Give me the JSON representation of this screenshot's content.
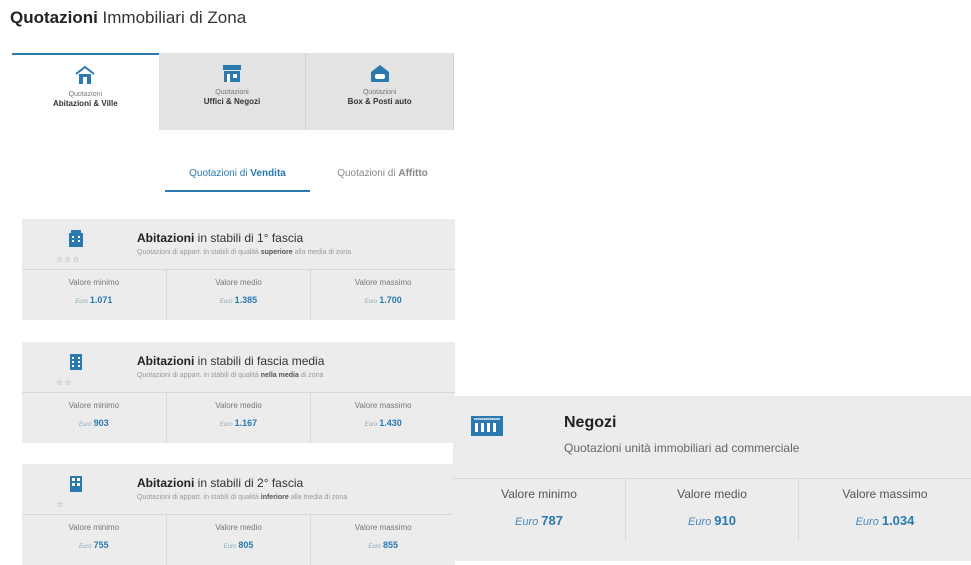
{
  "header": {
    "title_bold": "Quotazioni",
    "title_rest": " Immobiliari di Zona"
  },
  "tabs": [
    {
      "small": "Quotazioni",
      "big": "Abitazioni & Ville",
      "icon": "house-icon"
    },
    {
      "small": "Quotazioni",
      "big": "Uffici & Negozi",
      "icon": "shop-icon"
    },
    {
      "small": "Quotazioni",
      "big": "Box & Posti auto",
      "icon": "car-icon"
    }
  ],
  "subtabs": [
    {
      "prefix": "Quotazioni di ",
      "bold": "Vendita"
    },
    {
      "prefix": "Quotazioni di ",
      "bold": "Affitto"
    }
  ],
  "labels": {
    "min": "Valore minimo",
    "mid": "Valore medio",
    "max": "Valore massimo",
    "currency": "Euro"
  },
  "cards": [
    {
      "title_bold": "Abitazioni",
      "title_rest": " in stabili di 1° fascia",
      "sub_pre": "Quotazioni di appart. in stabili di qualità ",
      "sub_bold": "superiore",
      "sub_post": " alla media di zona",
      "stars": "☆☆☆",
      "min": "1.071",
      "mid": "1.385",
      "max": "1.700"
    },
    {
      "title_bold": "Abitazioni",
      "title_rest": " in stabili di fascia media",
      "sub_pre": "Quotazioni di appart. in stabili di qualità ",
      "sub_bold": "nella media",
      "sub_post": " di zona",
      "stars": "☆☆",
      "min": "903",
      "mid": "1.167",
      "max": "1.430"
    },
    {
      "title_bold": "Abitazioni",
      "title_rest": " in stabili di 2° fascia",
      "sub_pre": "Quotazioni di appart. in stabili di qualità ",
      "sub_bold": "inferiore",
      "sub_post": " alla media di zona",
      "stars": "☆",
      "min": "755",
      "mid": "805",
      "max": "855"
    }
  ],
  "negozi": {
    "title": "Negozi",
    "subtitle": "Quotazioni unità immobiliari ad commerciale",
    "min": "787",
    "mid": "910",
    "max": "1.034"
  },
  "colors": {
    "accent": "#2a7ab0",
    "panel": "#ececec"
  }
}
